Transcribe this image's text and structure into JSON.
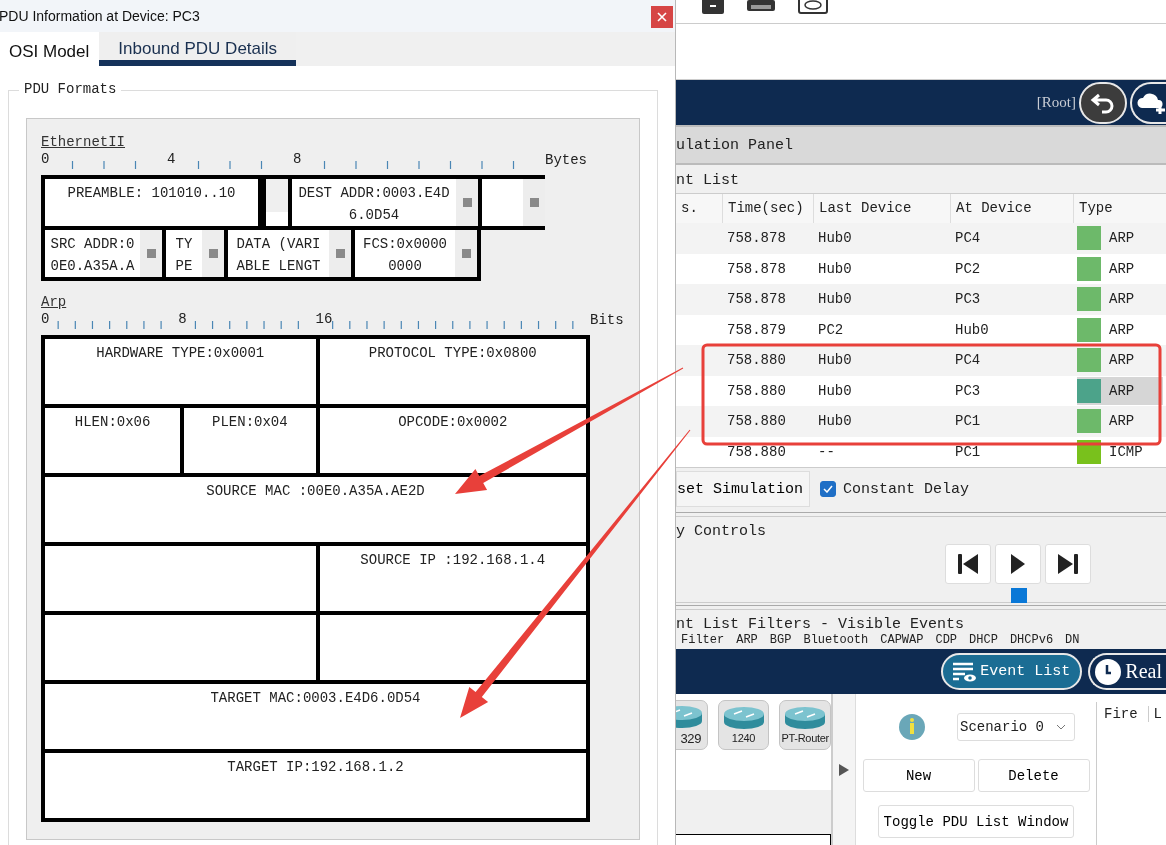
{
  "dialog": {
    "title": "PDU Information at Device: PC3",
    "tabs": [
      {
        "label": "OSI Model",
        "selected": false
      },
      {
        "label": "Inbound PDU Details",
        "selected": true
      }
    ],
    "group_title": "PDU Formats",
    "ethernet": {
      "title": "EthernetII",
      "ruler_labels": [
        "0",
        "4",
        "8"
      ],
      "unit": "Bytes",
      "rows": [
        [
          {
            "kind": "plain",
            "text": "PREAMBLE: 101010..10"
          },
          {
            "kind": "gap"
          },
          {
            "kind": "scroll",
            "text": "DEST ADDR:0003.E4D6.0D54"
          },
          {
            "kind": "open"
          }
        ],
        [
          {
            "kind": "scroll",
            "text": "SRC ADDR:00E0.A35A.A"
          },
          {
            "kind": "scroll",
            "text": "TYPE"
          },
          {
            "kind": "scroll",
            "text": "DATA (VARIABLE LENGT"
          },
          {
            "kind": "scroll",
            "text": "FCS:0x00000000"
          }
        ]
      ]
    },
    "arp": {
      "title": "Arp",
      "ruler_labels": [
        "0",
        "8",
        "16"
      ],
      "unit": "Bits",
      "words": [
        {
          "fields": [
            {
              "kind": "half",
              "text": "HARDWARE TYPE:0x0001"
            },
            {
              "kind": "half",
              "text": "PROTOCOL TYPE:0x0800"
            }
          ]
        },
        {
          "fields": [
            {
              "kind": "quarter",
              "text": "HLEN:0x06"
            },
            {
              "kind": "quarter",
              "text": "PLEN:0x04"
            },
            {
              "kind": "half",
              "text": "OPCODE:0x0002"
            }
          ]
        },
        {
          "fields": [
            {
              "kind": "full",
              "text": "SOURCE MAC :00E0.A35A.AE2D"
            }
          ]
        },
        {
          "fields": [
            {
              "kind": "half"
            },
            {
              "kind": "half",
              "text": "SOURCE IP :192.168.1.4"
            }
          ]
        },
        {
          "fields": [
            {
              "kind": "half"
            },
            {
              "kind": "half"
            }
          ]
        },
        {
          "fields": [
            {
              "kind": "full",
              "text": "TARGET MAC:0003.E4D6.0D54"
            }
          ]
        },
        {
          "fields": [
            {
              "kind": "full",
              "text": "TARGET IP:192.168.1.2"
            }
          ]
        }
      ]
    }
  },
  "app": {
    "breadcrumb": "[Root]",
    "panel_title": "ulation Panel",
    "event_list": {
      "title": "nt List",
      "columns": [
        "s.",
        "Time(sec)",
        "Last Device",
        "At Device",
        "Type"
      ],
      "rows": [
        {
          "time": "758.878",
          "last": "Hub0",
          "at": "PC4",
          "type": "ARP",
          "color": "#6db96a",
          "selected": false
        },
        {
          "time": "758.878",
          "last": "Hub0",
          "at": "PC2",
          "type": "ARP",
          "color": "#6db96a",
          "selected": false
        },
        {
          "time": "758.878",
          "last": "Hub0",
          "at": "PC3",
          "type": "ARP",
          "color": "#6db96a",
          "selected": false
        },
        {
          "time": "758.879",
          "last": "PC2",
          "at": "Hub0",
          "type": "ARP",
          "color": "#6db96a",
          "selected": false
        },
        {
          "time": "758.880",
          "last": "Hub0",
          "at": "PC4",
          "type": "ARP",
          "color": "#6db96a",
          "selected": false
        },
        {
          "time": "758.880",
          "last": "Hub0",
          "at": "PC3",
          "type": "ARP",
          "color": "#4ca38a",
          "selected": true
        },
        {
          "time": "758.880",
          "last": "Hub0",
          "at": "PC1",
          "type": "ARP",
          "color": "#6db96a",
          "selected": false
        },
        {
          "time": "758.880",
          "last": "--",
          "at": "PC1",
          "type": "ICMP",
          "color": "#79c11c",
          "selected": false
        }
      ]
    },
    "reset_button": "set Simulation",
    "constant_delay": {
      "label": "Constant Delay",
      "checked": true
    },
    "play_controls": {
      "title": "y Controls",
      "slider": {
        "level": 0.7
      }
    },
    "filters": {
      "title": "nt List Filters - Visible Events",
      "items": [
        "Filter",
        "ARP",
        "BGP",
        "Bluetooth",
        "CAPWAP",
        "CDP",
        "DHCP",
        "DHCPv6",
        "DN"
      ]
    },
    "mode_buttons": [
      {
        "label": "Event List",
        "selected": true
      },
      {
        "label": "Real",
        "selected": false
      }
    ],
    "devices": [
      "329",
      "1240",
      "PT-Router"
    ],
    "scenario": {
      "value": "Scenario 0",
      "buttons": [
        "New",
        "Delete"
      ],
      "toggle": "Toggle PDU List Window"
    },
    "pdu_list": {
      "columns": [
        "Fire",
        "L"
      ]
    }
  }
}
